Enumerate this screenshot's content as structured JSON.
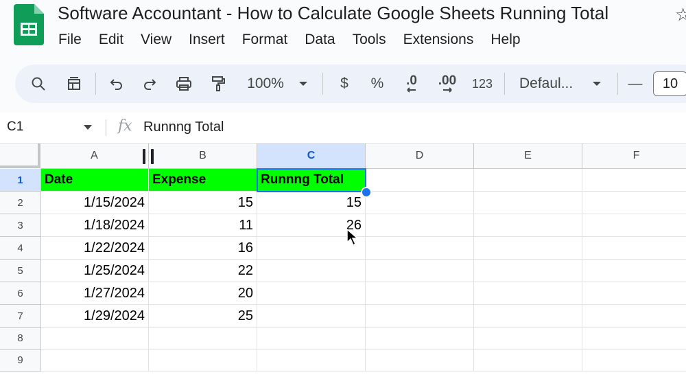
{
  "app": {
    "doc_title": "Software Accountant - How to Calculate Google Sheets Running Total",
    "logo_icon": "google-sheets-logo",
    "brand_color": "#0f9d58",
    "menu": [
      "File",
      "Edit",
      "View",
      "Insert",
      "Format",
      "Data",
      "Tools",
      "Extensions",
      "Help"
    ]
  },
  "toolbar": {
    "zoom": "100%",
    "currency": "$",
    "percent": "%",
    "decrease_decimal": ".0",
    "increase_decimal": ".00",
    "number_format": "123",
    "font": "Defaul...",
    "font_size_minus": "—",
    "font_size": "10"
  },
  "formula_bar": {
    "name_box": "C1",
    "fx": "fx",
    "content": "Runnng Total"
  },
  "sheet": {
    "columns": [
      "A",
      "B",
      "C",
      "D",
      "E",
      "F"
    ],
    "selected_column": "C",
    "selected_cell": "C1",
    "header_fill_color": "#00ff00",
    "rows": [
      {
        "num": "1",
        "cells": [
          "Date",
          "Expense",
          "Runnng Total",
          "",
          "",
          ""
        ]
      },
      {
        "num": "2",
        "cells": [
          "1/15/2024",
          "15",
          "15",
          "",
          "",
          ""
        ]
      },
      {
        "num": "3",
        "cells": [
          "1/18/2024",
          "11",
          "26",
          "",
          "",
          ""
        ]
      },
      {
        "num": "4",
        "cells": [
          "1/22/2024",
          "16",
          "",
          "",
          "",
          ""
        ]
      },
      {
        "num": "5",
        "cells": [
          "1/25/2024",
          "22",
          "",
          "",
          "",
          ""
        ]
      },
      {
        "num": "6",
        "cells": [
          "1/27/2024",
          "20",
          "",
          "",
          "",
          ""
        ]
      },
      {
        "num": "7",
        "cells": [
          "1/29/2024",
          "25",
          "",
          "",
          "",
          ""
        ]
      },
      {
        "num": "8",
        "cells": [
          "",
          "",
          "",
          "",
          "",
          ""
        ]
      },
      {
        "num": "9",
        "cells": [
          "",
          "",
          "",
          "",
          "",
          ""
        ]
      }
    ]
  }
}
